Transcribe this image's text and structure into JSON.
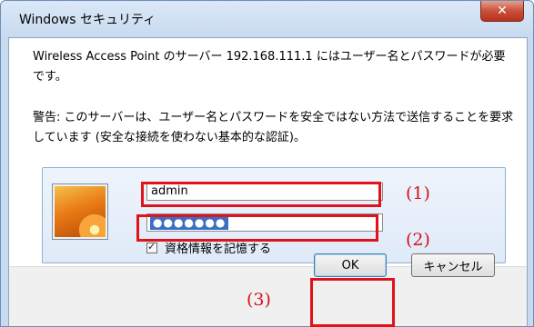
{
  "window": {
    "title": "Windows セキュリティ",
    "close_label": "✕"
  },
  "message": {
    "line1": "Wireless Access Point のサーバー 192.168.111.1 にはユーザー名とパスワードが必要です。",
    "line2": "警告: このサーバーは、ユーザー名とパスワードを安全ではない方法で送信することを要求しています (安全な接続を使わない基本的な認証)。"
  },
  "credentials": {
    "username_value": "admin",
    "password_mask": "●●●●●●●",
    "remember_label": "資格情報を記憶する",
    "remember_checked": true
  },
  "buttons": {
    "ok_label": "OK",
    "cancel_label": "キャンセル"
  },
  "annotations": {
    "label_1": "(1)",
    "label_2": "(2)",
    "label_3": "(3)",
    "color": "#e0121a"
  }
}
